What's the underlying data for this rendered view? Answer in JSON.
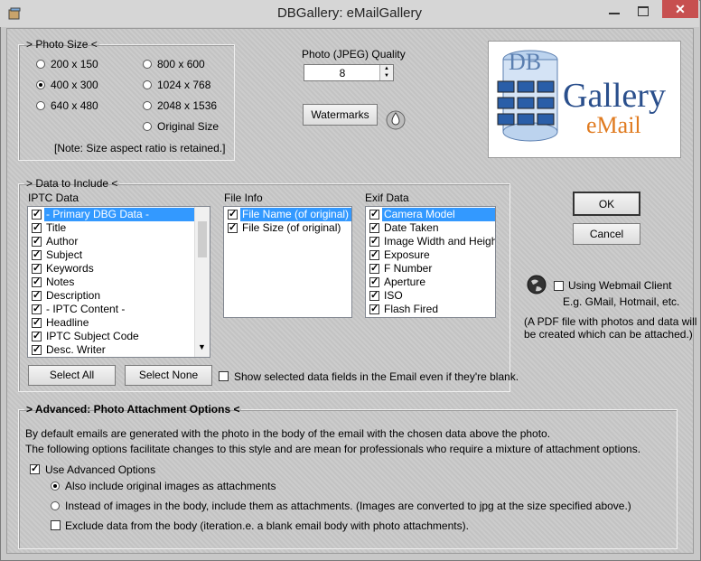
{
  "window": {
    "title": "DBGallery: eMailGallery",
    "close_glyph": "✕"
  },
  "photo_size": {
    "legend": "> Photo Size <",
    "options": [
      "200 x 150",
      "400 x 300",
      "640 x 480",
      "800 x 600",
      "1024 x 768",
      "2048 x 1536",
      "Original Size"
    ],
    "selected": "400 x 300",
    "note": "[Note: Size aspect ratio is retained.]"
  },
  "quality": {
    "label": "Photo (JPEG) Quality",
    "value": "8"
  },
  "watermarks_label": "Watermarks",
  "logo": {
    "db": "DB",
    "gallery": "Gallery",
    "email": "eMail"
  },
  "data_include": {
    "legend": "> Data to Include <",
    "iptc": {
      "header": "IPTC Data",
      "items": [
        "- Primary DBG Data -",
        "Title",
        "Author",
        "Subject",
        "Keywords",
        "Notes",
        "Description",
        "- IPTC Content -",
        "Headline",
        "IPTC Subject Code",
        "Desc. Writer"
      ]
    },
    "file": {
      "header": "File Info",
      "items": [
        "File Name (of original)",
        "File Size (of original)"
      ]
    },
    "exif": {
      "header": "Exif Data",
      "items": [
        "Camera Model",
        "Date Taken",
        "Image Width and Height",
        "Exposure",
        "F Number",
        "Aperture",
        "ISO",
        "Flash Fired"
      ]
    },
    "select_all": "Select All",
    "select_none": "Select None",
    "show_blank": "Show selected data fields in the Email even if they're blank."
  },
  "ok_label": "OK",
  "cancel_label": "Cancel",
  "webmail": {
    "label": "Using Webmail Client",
    "eg": "E.g. GMail, Hotmail, etc.",
    "pdf_note1": "(A PDF file with photos and data will",
    "pdf_note2": "be created which can be attached.)"
  },
  "advanced": {
    "legend": "> Advanced: Photo Attachment Options <",
    "line1": "By default emails are generated with the photo in the body of the email with the chosen data above the photo.",
    "line2": "The following options facilitate changes to this style and are mean for professionals who require a mixture of attachment options.",
    "use_label": "Use Advanced Options",
    "opt1": "Also include original images as attachments",
    "opt2": "Instead of images in the body, include them as attachments.  (Images are converted to jpg at the size specified above.)",
    "opt3": "Exclude data from the body (iteration.e. a blank email body with photo attachments)."
  },
  "colors": {
    "selection": "#3399ff",
    "close": "#c75050"
  }
}
